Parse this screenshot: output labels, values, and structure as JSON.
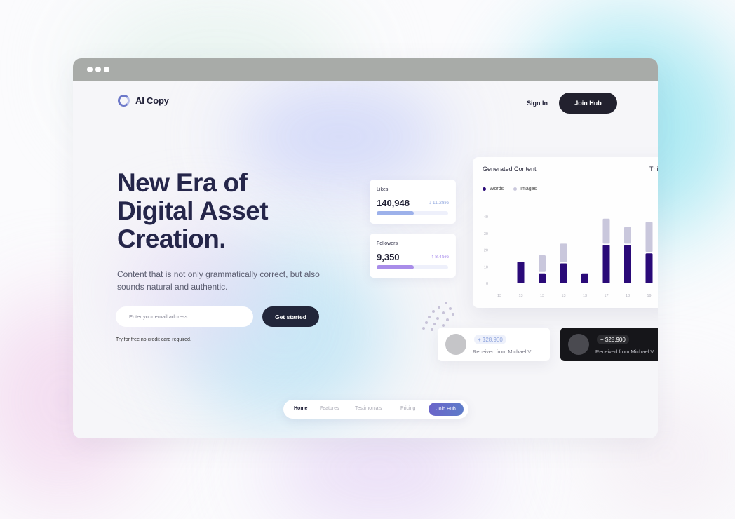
{
  "brand": {
    "name": "AI Copy"
  },
  "header": {
    "signin_label": "Sign In",
    "join_label": "Join Hub"
  },
  "hero": {
    "title_lines": [
      "New Era of",
      "Digital Asset",
      "Creation."
    ],
    "subtitle": "Content that is not only grammatically correct, but also sounds natural and authentic.",
    "email_placeholder": "Enter your email address",
    "cta_label": "Get started",
    "note": "Try for free no credit card required."
  },
  "stats": [
    {
      "label": "Likes",
      "value": "140,948",
      "change": "↓ 11.28%",
      "change_color": "#8fa6de",
      "fill_pct": 52,
      "fill_color": "#9db1ea"
    },
    {
      "label": "Followers",
      "value": "9,350",
      "change": "↑ 8.45%",
      "change_color": "#a78bec",
      "fill_pct": 52,
      "fill_color": "#a98de9"
    }
  ],
  "chart_data": {
    "type": "bar",
    "title": "Generated Content",
    "extra_label": "Thi",
    "series": [
      {
        "name": "Words",
        "color": "#2a0a78",
        "values": [
          null,
          13,
          6,
          12,
          6,
          23,
          23,
          18
        ]
      },
      {
        "name": "Images",
        "color": "#c9c7dc",
        "values": [
          null,
          null,
          10,
          11,
          null,
          15,
          10,
          18
        ]
      }
    ],
    "categories": [
      "13",
      "13",
      "13",
      "13",
      "13",
      "17",
      "18",
      "19"
    ],
    "y_ticks": [
      "0",
      "10",
      "20",
      "30",
      "40"
    ],
    "ylim": [
      0,
      40
    ]
  },
  "payments": [
    {
      "amount": "+ $28,900",
      "from": "Received from Michael V"
    },
    {
      "amount": "+ $28,900",
      "from": "Received from Michael V"
    }
  ],
  "nav": {
    "items": [
      "Home",
      "Features",
      "Testimonials",
      "Pricing"
    ],
    "active": "Home",
    "join_label": "Join Hub"
  }
}
